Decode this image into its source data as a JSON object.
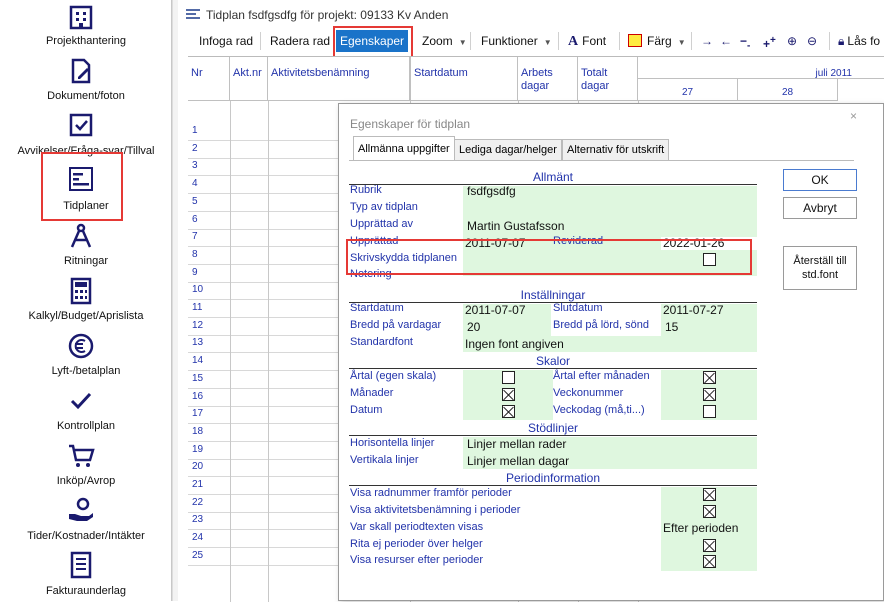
{
  "sidebar": {
    "items": [
      {
        "label": "Projekthantering",
        "icon": "building-icon"
      },
      {
        "label": "Dokument/foton",
        "icon": "document-edit-icon"
      },
      {
        "label": "Avvikelser/Fråga-svar/Tillval",
        "icon": "checkbox-icon"
      },
      {
        "label": "Tidplaner",
        "icon": "gantt-icon"
      },
      {
        "label": "Ritningar",
        "icon": "compass-icon"
      },
      {
        "label": "Kalkyl/Budget/Aprislista",
        "icon": "calculator-icon"
      },
      {
        "label": "Lyft-/betalplan",
        "icon": "euro-icon"
      },
      {
        "label": "Kontrollplan",
        "icon": "checkmark-icon"
      },
      {
        "label": "Inköp/Avrop",
        "icon": "cart-icon"
      },
      {
        "label": "Tider/Kostnader/Intäkter",
        "icon": "hand-money-icon"
      },
      {
        "label": "Fakturaunderlag",
        "icon": "invoice-icon"
      }
    ]
  },
  "window": {
    "title": "Tidplan fsdfgsdfg för projekt: 09133 Kv Anden"
  },
  "toolbar": {
    "insert_row": "Infoga rad",
    "delete_row": "Radera rad",
    "properties": "Egenskaper",
    "zoom": "Zoom",
    "functions": "Funktioner",
    "font": "Font",
    "color": "Färg",
    "lock": "Lås fo"
  },
  "grid": {
    "headers": {
      "nr": "Nr",
      "akt_nr": "Akt.nr",
      "activity": "Aktivitetsbenämning",
      "start": "Startdatum",
      "work_days": "Arbets dagar",
      "total_days": "Totalt dagar"
    },
    "month_label": "juli 2011",
    "week_labels": [
      "27",
      "28"
    ],
    "rows": [
      "1",
      "2",
      "3",
      "4",
      "5",
      "6",
      "7",
      "8",
      "9",
      "10",
      "11",
      "12",
      "13",
      "14",
      "15",
      "16",
      "17",
      "18",
      "19",
      "20",
      "21",
      "22",
      "23",
      "24",
      "25"
    ]
  },
  "dialog": {
    "title": "Egenskaper för tidplan",
    "close": "×",
    "tabs": [
      "Allmänna uppgifter",
      "Lediga dagar/helger",
      "Alternativ för utskrift"
    ],
    "ok": "OK",
    "cancel": "Avbryt",
    "reset_font": "Återställ till std.font",
    "general": {
      "heading": "Allmänt",
      "rubrik_label": "Rubrik",
      "rubrik_value": "fsdfgsdfg",
      "type_label": "Typ av tidplan",
      "author_label": "Upprättad av",
      "author_value": "Martin Gustafsson",
      "created_label": "Upprättad",
      "created_value": "2011-07-07",
      "revised_label": "Reviderad",
      "revised_value": "2022-01-26",
      "write_protect_label": "Skrivskydda tidplanen",
      "write_protect_checked": false,
      "note_label": "Notering"
    },
    "settings": {
      "heading": "Inställningar",
      "start_label": "Startdatum",
      "start_value": "2011-07-07",
      "end_label": "Slutdatum",
      "end_value": "2011-07-27",
      "width_weekday_label": "Bredd på vardagar",
      "width_weekday_value": "20",
      "width_weekend_label": "Bredd på lörd, sönd",
      "width_weekend_value": "15",
      "std_font_label": "Standardfont",
      "std_font_value": "Ingen font angiven"
    },
    "scales": {
      "heading": "Skalor",
      "year_label": "Årtal (egen skala)",
      "year_checked": false,
      "year_after_label": "Årtal efter månaden",
      "year_after_checked": true,
      "months_label": "Månader",
      "months_checked": true,
      "week_no_label": "Veckonummer",
      "week_no_checked": true,
      "date_label": "Datum",
      "date_checked": true,
      "weekday_label": "Veckodag (må,ti...)",
      "weekday_checked": false
    },
    "gridlines": {
      "heading": "Stödlinjer",
      "horizontal_label": "Horisontella linjer",
      "horizontal_value": "Linjer mellan rader",
      "vertical_label": "Vertikala linjer",
      "vertical_value": "Linjer mellan dagar"
    },
    "period": {
      "heading": "Periodinformation",
      "show_rownr_label": "Visa radnummer framför perioder",
      "show_rownr_checked": true,
      "show_name_label": "Visa aktivitetsbenämning i perioder",
      "show_name_checked": true,
      "text_pos_label": "Var skall periodtexten visas",
      "text_pos_value": "Efter perioden",
      "no_holidays_label": "Rita ej perioder över helger",
      "no_holidays_checked": true,
      "show_resources_label": "Visa resurser efter perioder",
      "show_resources_checked": true
    }
  },
  "colors": {
    "highlight": "#e53935",
    "accent_blue": "#2233aa",
    "green_field": "#dff7df",
    "active_button": "#1a73c9"
  }
}
